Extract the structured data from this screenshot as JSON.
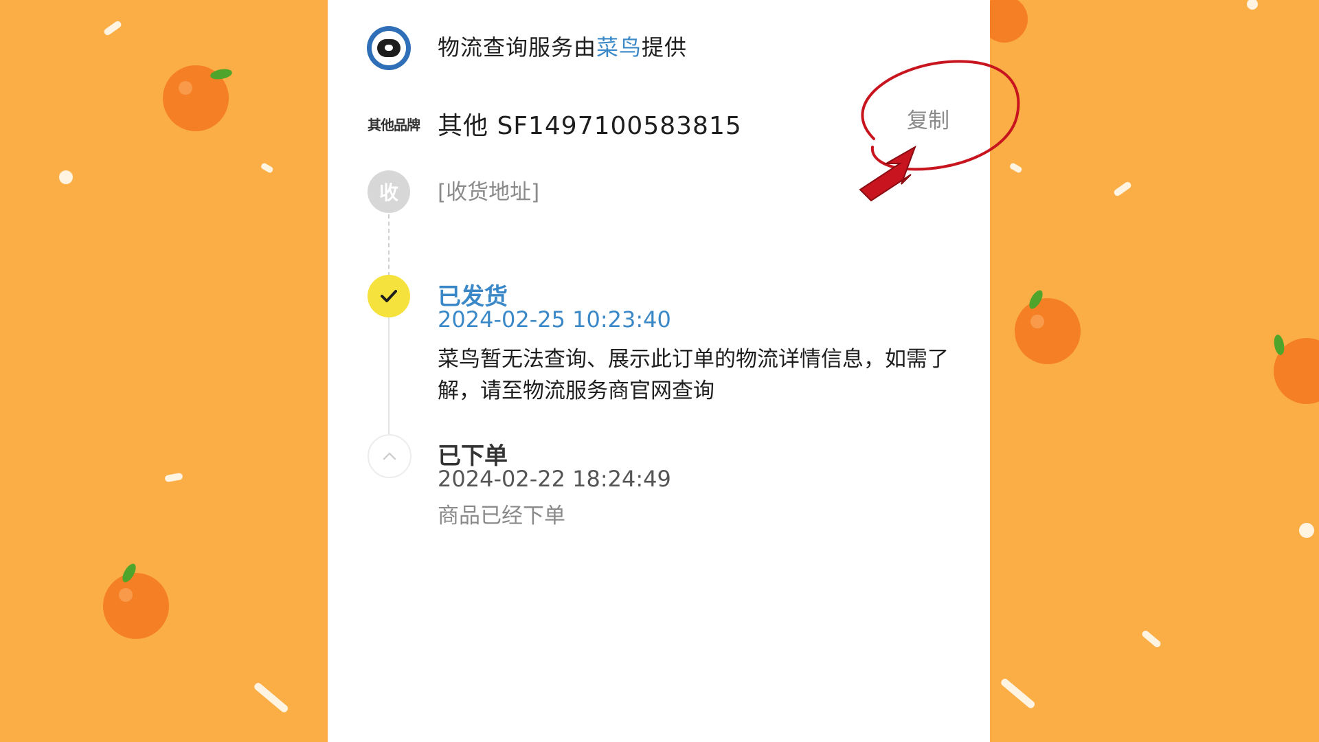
{
  "service": {
    "prefix": "物流查询服务由",
    "brand": "菜鸟",
    "suffix": "提供",
    "logo_icon": "cainiao-logo-icon"
  },
  "shipment": {
    "brand_tag": "其他品牌",
    "tracking_text": "其他 SF1497100583815",
    "copy_label": "复制"
  },
  "receive": {
    "badge": "收",
    "address_placeholder": "[收货地址]"
  },
  "timeline": [
    {
      "status": "已发货",
      "time": "2024-02-25 10:23:40",
      "description": "菜鸟暂无法查询、展示此订单的物流详情信息，如需了解，请至物流服务商官网查询",
      "icon": "check-icon"
    },
    {
      "status": "已下单",
      "time": "2024-02-22 18:24:49",
      "description": "商品已经下单",
      "icon": "chevron-up-icon"
    }
  ],
  "colors": {
    "background": "#fbae45",
    "brand_blue": "#3a88c7",
    "check_yellow": "#f6e23d",
    "annotation_red": "#c8141e"
  }
}
